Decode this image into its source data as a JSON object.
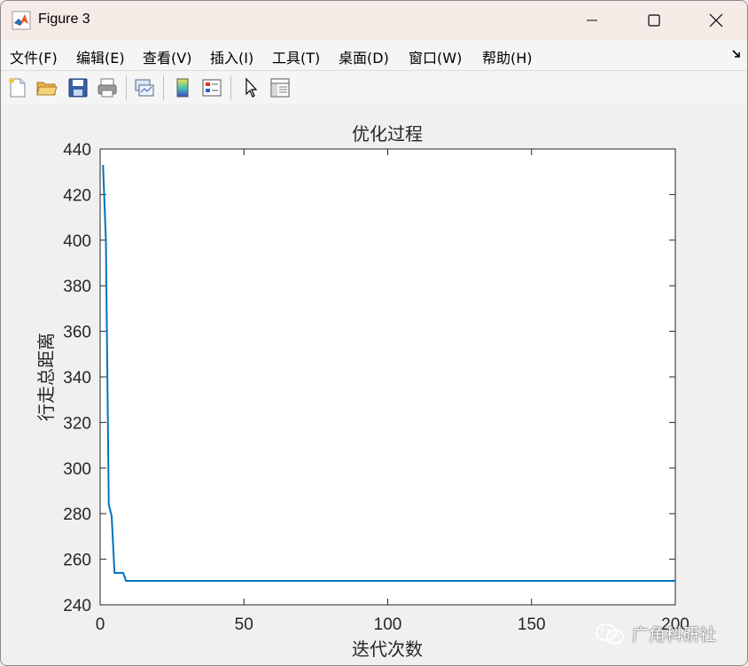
{
  "window": {
    "title": "Figure 3",
    "controls": {
      "minimize_icon": "minimize-icon",
      "maximize_icon": "maximize-icon",
      "close_icon": "close-icon"
    }
  },
  "menubar": {
    "items": [
      {
        "label": "文件(F)"
      },
      {
        "label": "编辑(E)"
      },
      {
        "label": "查看(V)"
      },
      {
        "label": "插入(I)"
      },
      {
        "label": "工具(T)"
      },
      {
        "label": "桌面(D)"
      },
      {
        "label": "窗口(W)"
      },
      {
        "label": "帮助(H)"
      }
    ]
  },
  "toolbar": {
    "buttons": [
      {
        "icon": "new-figure-icon"
      },
      {
        "icon": "open-file-icon"
      },
      {
        "icon": "save-icon"
      },
      {
        "icon": "print-icon"
      },
      {
        "icon": "link-plot-icon"
      },
      {
        "icon": "colorbar-icon"
      },
      {
        "icon": "legend-icon"
      },
      {
        "icon": "edit-plot-icon"
      },
      {
        "icon": "property-inspector-icon"
      }
    ]
  },
  "chart_data": {
    "type": "line",
    "title": "优化过程",
    "xlabel": "迭代次数",
    "ylabel": "行走总距离",
    "xlim": [
      0,
      200
    ],
    "ylim": [
      240,
      440
    ],
    "xticks": [
      "0",
      "50",
      "100",
      "150",
      "200"
    ],
    "yticks": [
      "240",
      "260",
      "280",
      "300",
      "320",
      "340",
      "360",
      "380",
      "400",
      "420",
      "440"
    ],
    "grid": false,
    "line_color": "#0072bd",
    "series": [
      {
        "x": [
          1,
          2,
          3,
          4,
          5,
          6,
          7,
          8,
          9,
          10,
          200
        ],
        "y": [
          433,
          400,
          284,
          279,
          254,
          254,
          254,
          254,
          250.5,
          250.5,
          250.5
        ]
      }
    ]
  },
  "watermark": {
    "text": "广角科研社",
    "icon": "wechat-icon"
  }
}
